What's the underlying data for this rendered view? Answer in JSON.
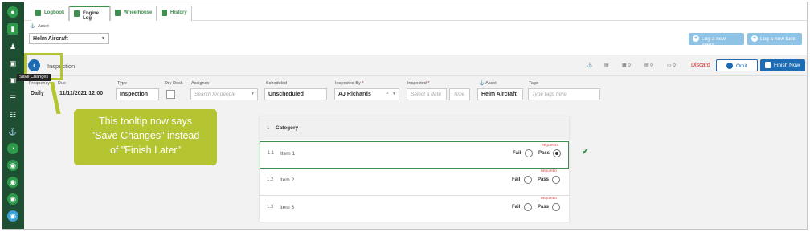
{
  "tabs": [
    {
      "label": "Logbook",
      "active": false
    },
    {
      "label": "Engine Log",
      "active": true
    },
    {
      "label": "Wheelhouse",
      "active": false
    },
    {
      "label": "History",
      "active": false
    }
  ],
  "asset_bar": {
    "asset_label": "Asset",
    "asset_value": "Helm Aircraft",
    "log_event_label": "Log a new event",
    "log_task_label": "Log a new task"
  },
  "header": {
    "title": "Inspection",
    "discard_label": "Discard",
    "omit_label": "Omit",
    "finish_label": "Finish Now",
    "counts": [
      "0",
      "0",
      "0"
    ]
  },
  "tooltip": "Save Changes",
  "form": {
    "frequency": {
      "label": "Frequency",
      "value": "Daily"
    },
    "due": {
      "label": "Due",
      "value": "11/11/2021 12:00"
    },
    "type": {
      "label": "Type",
      "value": "Inspection"
    },
    "dry_dock": {
      "label": "Dry Dock"
    },
    "assignee": {
      "label": "Assignee",
      "placeholder": "Search for people"
    },
    "scheduled": {
      "label": "Scheduled",
      "value": "Unscheduled"
    },
    "inspected_by": {
      "label": "Inspected By",
      "value": "AJ Richards"
    },
    "inspected": {
      "label": "Inspected",
      "date_placeholder": "Select a date",
      "time_placeholder": "Time"
    },
    "asset": {
      "label": "Asset",
      "value": "Helm Aircraft"
    },
    "tags": {
      "label": "Tags",
      "placeholder": "Type tags here"
    }
  },
  "checklist": {
    "category": {
      "num": "1",
      "label": "Category"
    },
    "items": [
      {
        "num": "1.1",
        "label": "Item 1",
        "required": "REQUIRED",
        "fail": "Fail",
        "pass": "Pass",
        "selected": "pass"
      },
      {
        "num": "1.2",
        "label": "Item 2",
        "required": "REQUIRED",
        "fail": "Fail",
        "pass": "Pass",
        "selected": null
      },
      {
        "num": "1.3",
        "label": "Item 3",
        "required": "REQUIRED",
        "fail": "Fail",
        "pass": "Pass",
        "selected": null
      }
    ]
  },
  "callout": {
    "line1": "This tooltip now says",
    "line2": "\"Save Changes\" instead",
    "line3": "of \"Finish Later\""
  },
  "colors": {
    "nav_bg": "#1e4f33",
    "primary": "#1d6cb3",
    "accent_green": "#3f8f4f",
    "callout": "#b5c431",
    "danger": "#d0312d"
  }
}
